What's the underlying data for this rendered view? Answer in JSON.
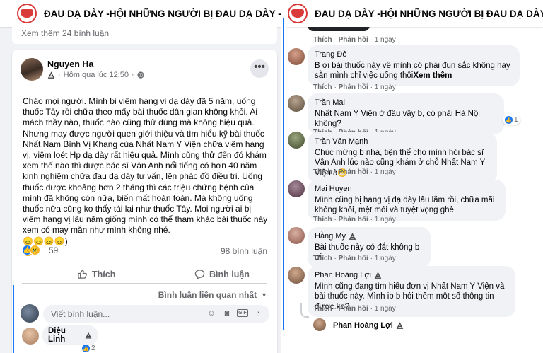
{
  "header": {
    "title": "ĐAU DẠ DÀY -HỘI NHỮNG NGƯỜI BỊ ĐAU DẠ DÀY - GIÚ..."
  },
  "left": {
    "view_more": "Xem thêm 24 bình luận",
    "post": {
      "author": "Nguyen Ha",
      "time": "Hôm qua lúc 12:50",
      "more": "•••",
      "body": "Chào mọi người. Mình bị viêm hang vị dạ dày đã 5 năm, uống thuốc Tây rồi chữa theo mấy bài thuốc dân gian không khỏi. Ai mách thầy nào, thuốc nào cũng thử dùng mà không hiệu quả. Nhưng may được người quen giới thiệu và tìm hiểu kỹ bài thuốc Nhất Nam Bình Vị Khang của Nhất Nam Y Viện chữa viêm hang vị, viêm loét Hp dạ dày rất hiệu quả. Mình cũng thử đến đó khám xem thế nào thì được bác sĩ Vân Anh nổi tiếng có hơn 40 năm kinh nghiệm chữa đau dạ dày tư vấn, lên phác đồ điều trị. Uống thuốc được khoảng hơn 2 tháng thì các triệu chứng bệnh của mình đã không còn nữa, biến mất hoàn toàn. Mà không uống thuốc nữa cũng ko thấy tái lại như thuốc Tây. Mọi người ai bị viêm hang vị lâu năm giống mình có thể tham khảo bài thuốc này xem có may mắn như mình không nhé.",
      "emoji_line": "😞😞😞😞)",
      "emoji_line2": "😞",
      "reaction_count": "59",
      "comment_count": "98 bình luận",
      "like_label": "Thích",
      "comment_label": "Bình luận",
      "sort_label": "Bình luận liên quan nhất",
      "compose_placeholder": "Viết bình luận...",
      "first_comment_author": "Diệu Linh",
      "first_comment_likes": "2"
    }
  },
  "right": {
    "meta_top": {
      "like": "Thích",
      "reply": "Phản hồi",
      "time": "1 ngày"
    },
    "comments": [
      {
        "author": "Trang Đỗ",
        "text": "B ơi bài thuốc này về mình có phải đun sắc không hay sẵn mình chỉ việc uống thôi",
        "see_more": "Xem thêm",
        "like": "Thích",
        "reply": "Phản hồi",
        "time": "1 ngày",
        "likes": ""
      },
      {
        "author": "Trần Mai",
        "text": "Nhất Nam Y Viện ở đâu vậy b, có phải Hà Nội không?",
        "see_more": "",
        "like": "Thích",
        "reply": "Phản hồi",
        "time": "1 ngày",
        "likes": "1"
      },
      {
        "author": "Trần Văn Mạnh",
        "text": "Chúc mừng b nha, tiện thể cho mình hỏi bác sĩ Vân Anh lúc nào cũng khám ở chỗ Nhất Nam Y Viện à😁",
        "see_more": "",
        "like": "Thích",
        "reply": "Phản hồi",
        "time": "1 ngày",
        "likes": ""
      },
      {
        "author": "Mai Huyen",
        "text": "Mình cũng bị hang vị dạ dày lâu lắm rồi, chữa mãi không khỏi, mệt mỏi và tuyệt vọng ghê",
        "see_more": "",
        "like": "Thích",
        "reply": "Phản hồi",
        "time": "1 ngày",
        "likes": ""
      },
      {
        "author": "Hằng My",
        "text": "Bài thuốc này có đắt không b ơi",
        "see_more": "",
        "like": "Thích",
        "reply": "Phản hồi",
        "time": "1 ngày",
        "likes": ""
      },
      {
        "author": "Phan Hoàng Lợi",
        "text": "Mình cũng đang tìm hiểu đơn vị Nhất Nam Y Viện và bài thuốc này. Mình ib b hỏi thêm một số thông tin được ko?",
        "see_more": "",
        "like": "Thích",
        "reply": "Phản hồi",
        "time": "1 ngày",
        "likes": ""
      }
    ],
    "reply_author": "Phan Hoàng Lợi"
  },
  "colors": {
    "accent": "#1877f2",
    "bubble": "#f0f2f5",
    "muted": "#65676b",
    "logo": "#d93a3a"
  }
}
